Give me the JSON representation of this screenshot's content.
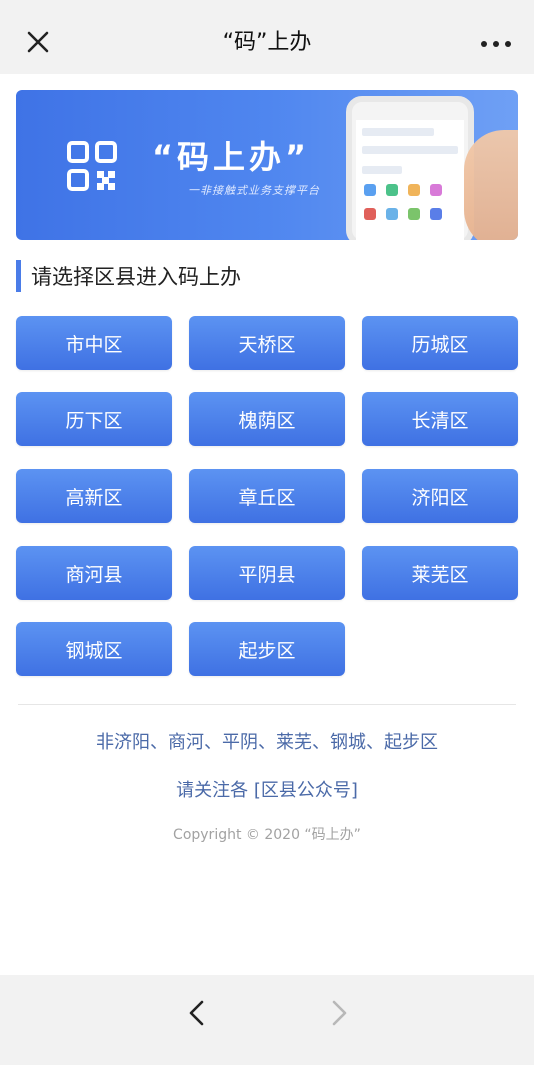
{
  "header": {
    "title": "“码”上办",
    "close_icon": "close-icon",
    "more_icon": "more-icon"
  },
  "banner": {
    "title": "“码上办”",
    "subtitle": "一非接触式业务支撑平台",
    "qr_icon": "qr-code-icon"
  },
  "section": {
    "title": "请选择区县进入码上办"
  },
  "districts": [
    {
      "label": "市中区"
    },
    {
      "label": "天桥区"
    },
    {
      "label": "历城区"
    },
    {
      "label": "历下区"
    },
    {
      "label": "槐荫区"
    },
    {
      "label": "长清区"
    },
    {
      "label": "高新区"
    },
    {
      "label": "章丘区"
    },
    {
      "label": "济阳区"
    },
    {
      "label": "商河县"
    },
    {
      "label": "平阴县"
    },
    {
      "label": "莱芜区"
    },
    {
      "label": "钢城区"
    },
    {
      "label": "起步区"
    }
  ],
  "footer": {
    "note1": "非济阳、商河、平阴、莱芜、钢城、起步区",
    "note2": "请关注各 [区县公众号]",
    "copyright": "Copyright © 2020 “码上办”"
  },
  "nav": {
    "back_icon": "chevron-left-icon",
    "forward_icon": "chevron-right-icon"
  },
  "colors": {
    "accent": "#4a7ce8",
    "button_top": "#5c93f2",
    "button_bottom": "#3f71e3",
    "link_text": "#4b6aa8"
  }
}
